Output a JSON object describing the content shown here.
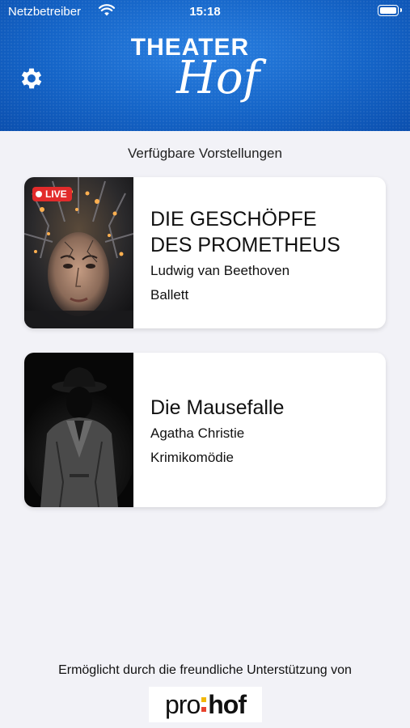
{
  "status_bar": {
    "carrier": "Netzbetreiber",
    "time": "15:18",
    "wifi_icon": "wifi-icon",
    "battery_icon": "battery-icon"
  },
  "header": {
    "logo_top": "THEATER",
    "logo_bottom": "Hof",
    "settings_icon": "gear-icon",
    "background_color": "#1565c8"
  },
  "section_title": "Verfügbare Vorstellungen",
  "performances": [
    {
      "title_line1": "DIE GESCHÖPFE",
      "title_line2": "DES PROMETHEUS",
      "author": "Ludwig van Beethoven",
      "genre": "Ballett",
      "badge": "LIVE",
      "badge_color": "#e22b2b"
    },
    {
      "title_line1": "Die Mausefalle",
      "author": "Agatha Christie",
      "genre": "Krimikomödie"
    }
  ],
  "footer": {
    "support_text": "Ermöglicht durch die freundliche Unterstützung von",
    "sponsor_pro": "pro",
    "sponsor_hof": "hof",
    "sponsor_colon_colors": [
      "#f2b705",
      "#e8432e"
    ]
  }
}
